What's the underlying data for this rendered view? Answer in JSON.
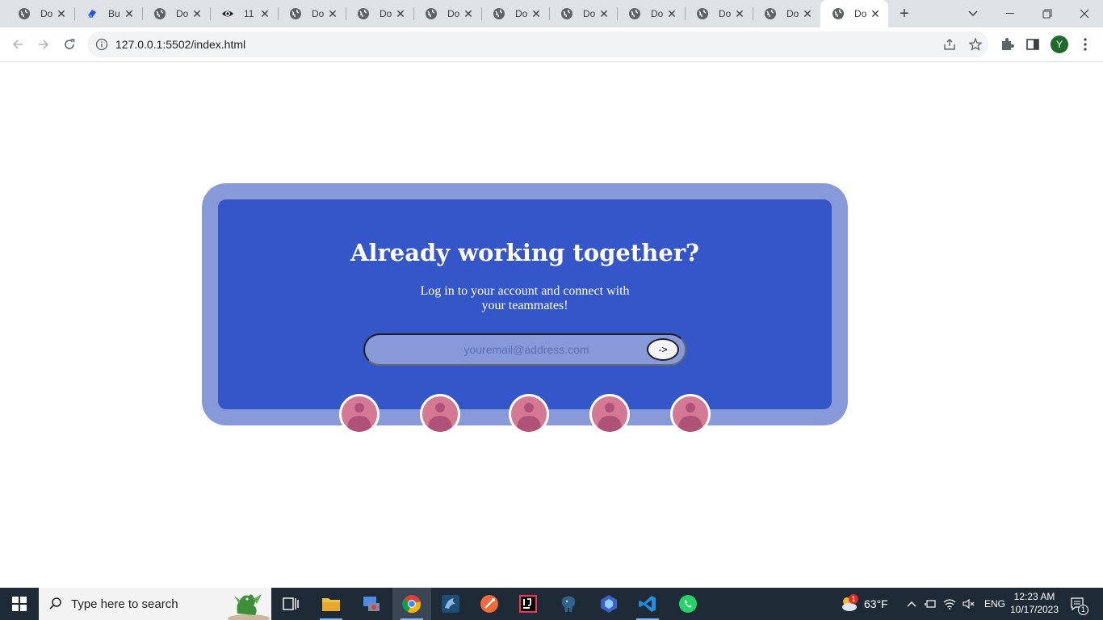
{
  "browser": {
    "tabs": [
      {
        "title": "Do",
        "favicon": "globe-icon"
      },
      {
        "title": "Bu",
        "favicon": "app-icon"
      },
      {
        "title": "Do",
        "favicon": "globe-icon"
      },
      {
        "title": "11",
        "favicon": "eye-icon"
      },
      {
        "title": "Do",
        "favicon": "globe-icon"
      },
      {
        "title": "Do",
        "favicon": "globe-icon"
      },
      {
        "title": "Do",
        "favicon": "globe-icon"
      },
      {
        "title": "Do",
        "favicon": "globe-icon"
      },
      {
        "title": "Do",
        "favicon": "globe-icon"
      },
      {
        "title": "Do",
        "favicon": "globe-icon"
      },
      {
        "title": "Do",
        "favicon": "globe-icon"
      },
      {
        "title": "Do",
        "favicon": "globe-icon"
      },
      {
        "title": "Do",
        "favicon": "globe-icon",
        "active": true
      }
    ],
    "url": "127.0.0.1:5502/index.html",
    "profile_initial": "Y"
  },
  "page": {
    "heading": "Already working together?",
    "subtitle_line1": "Log in to your account and connect with",
    "subtitle_line2": "your teammates!",
    "email_placeholder": "youremail@address.com",
    "submit_label": "->",
    "avatar_count": 5
  },
  "taskbar": {
    "search_placeholder": "Type here to search",
    "weather_temp": "63°F",
    "weather_badge": "1",
    "language": "ENG",
    "time": "12:23 AM",
    "date": "10/17/2023",
    "notification_count": "1"
  },
  "colors": {
    "card_outer": "#8799d9",
    "card_inner": "#3556c9",
    "avatar": "#d57895",
    "avatar_figure": "#b05277"
  }
}
